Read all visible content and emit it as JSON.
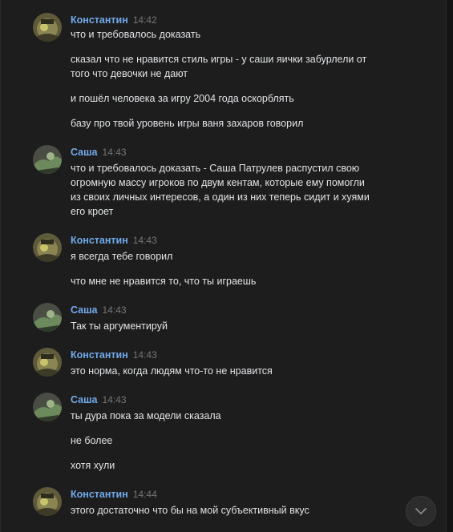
{
  "messages": [
    {
      "author": "Константин",
      "time": "14:42",
      "avatar_icon": "konstantin-avatar-icon",
      "lines": [
        "что и требовалось доказать",
        "сказал что не нравится стиль игры - у саши яички забурлели от того что девочки не дают",
        "и пошёл человека за игру 2004 года оскорблять",
        "базу про твой уровень игры ваня захаров говорил"
      ]
    },
    {
      "author": "Саша",
      "time": "14:43",
      "avatar_icon": "sasha-avatar-icon",
      "lines": [
        "что и требовалось доказать - Саша Патрулев распустил свою огромную массу игроков по двум кентам, которые ему помогли из своих личных интересов, а один из них теперь сидит и хуями его кроет"
      ]
    },
    {
      "author": "Константин",
      "time": "14:43",
      "avatar_icon": "konstantin-avatar-icon",
      "lines": [
        "я всегда тебе говорил",
        "что мне не нравится то, что ты играешь"
      ]
    },
    {
      "author": "Саша",
      "time": "14:43",
      "avatar_icon": "sasha-avatar-icon",
      "lines": [
        "Так ты аргументируй"
      ]
    },
    {
      "author": "Константин",
      "time": "14:43",
      "avatar_icon": "konstantin-avatar-icon",
      "lines": [
        "это норма, когда людям что-то не нравится"
      ]
    },
    {
      "author": "Саша",
      "time": "14:43",
      "avatar_icon": "sasha-avatar-icon",
      "lines": [
        "ты дура пока за модели сказала",
        "не более",
        "хотя хули"
      ]
    },
    {
      "author": "Константин",
      "time": "14:44",
      "avatar_icon": "konstantin-avatar-icon",
      "lines": [
        "этого достаточно что бы на мой субъективный вкус"
      ]
    }
  ],
  "scroll_button_icon": "chevron-down-icon",
  "colors": {
    "background": "#1d1d1d",
    "author": "#71aaeb",
    "text": "#e1e3e6",
    "time": "#767676"
  }
}
